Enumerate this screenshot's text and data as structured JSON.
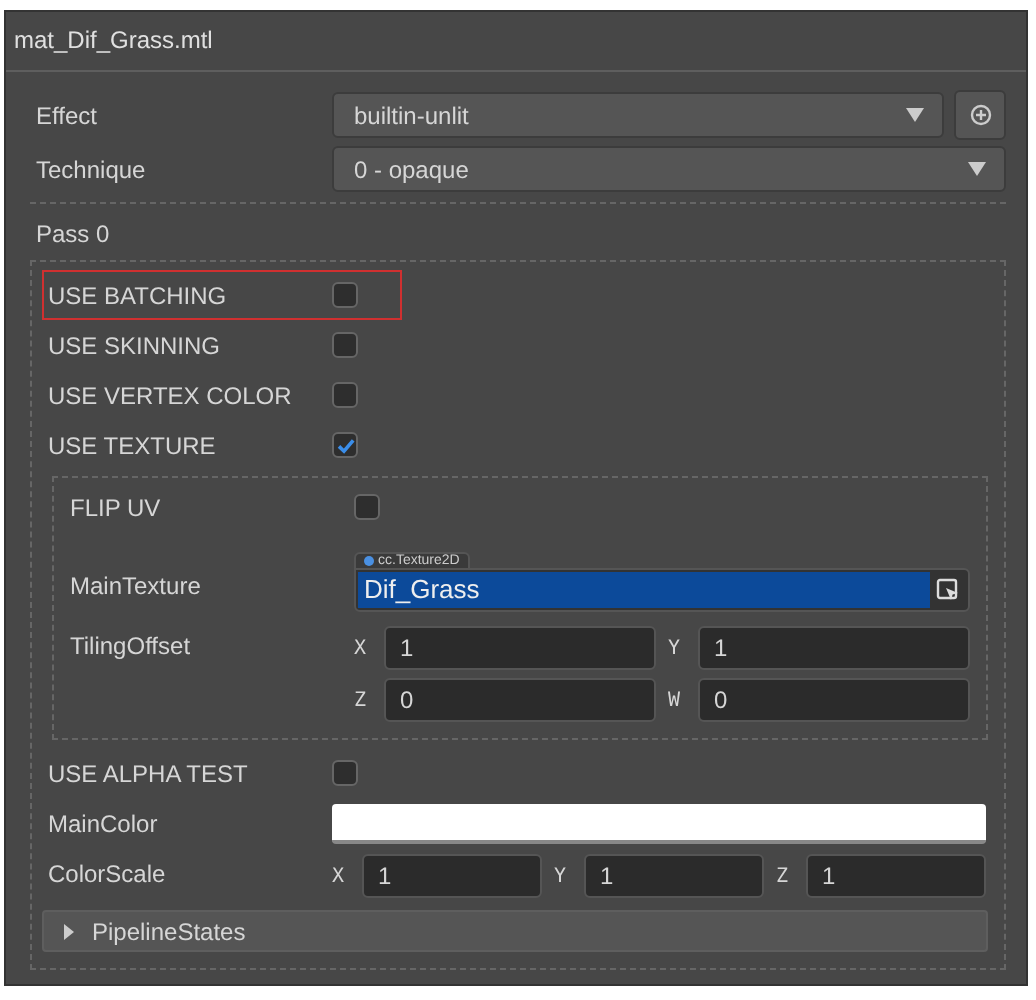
{
  "title": "mat_Dif_Grass.mtl",
  "properties": [
    {
      "kind": "select",
      "label": "Effect",
      "value": "builtin-unlit",
      "locate": true
    },
    {
      "kind": "select",
      "label": "Technique",
      "value": "0 - opaque"
    }
  ],
  "pass": {
    "title": "Pass 0",
    "rows": [
      {
        "kind": "checkbox",
        "label": "USE BATCHING",
        "checked": false,
        "highlighted": true
      },
      {
        "kind": "checkbox",
        "label": "USE SKINNING",
        "checked": false,
        "highlighted": false
      },
      {
        "kind": "checkbox",
        "label": "USE VERTEX COLOR",
        "checked": false,
        "highlighted": false
      },
      {
        "kind": "checkbox",
        "label": "USE TEXTURE",
        "checked": true,
        "highlighted": false,
        "children": [
          {
            "kind": "checkbox",
            "label": "FLIP UV",
            "checked": false,
            "highlighted": false
          },
          {
            "kind": "texture",
            "label": "MainTexture",
            "type": "cc.Texture2D",
            "value": "Dif_Grass"
          },
          {
            "kind": "vector",
            "label": "TilingOffset",
            "fields": [
              {
                "axis": "X",
                "value": "1"
              },
              {
                "axis": "Y",
                "value": "1"
              },
              {
                "axis": "Z",
                "value": "0"
              },
              {
                "axis": "W",
                "value": "0"
              }
            ]
          }
        ]
      },
      {
        "kind": "checkbox",
        "label": "USE ALPHA TEST",
        "checked": false,
        "highlighted": false
      },
      {
        "kind": "color",
        "label": "MainColor",
        "color": "#ffffff"
      },
      {
        "kind": "vector",
        "label": "ColorScale",
        "fields": [
          {
            "axis": "X",
            "value": "1"
          },
          {
            "axis": "Y",
            "value": "1"
          },
          {
            "axis": "Z",
            "value": "1"
          }
        ]
      },
      {
        "kind": "foldout",
        "label": "PipelineStates",
        "expanded": false
      }
    ]
  }
}
